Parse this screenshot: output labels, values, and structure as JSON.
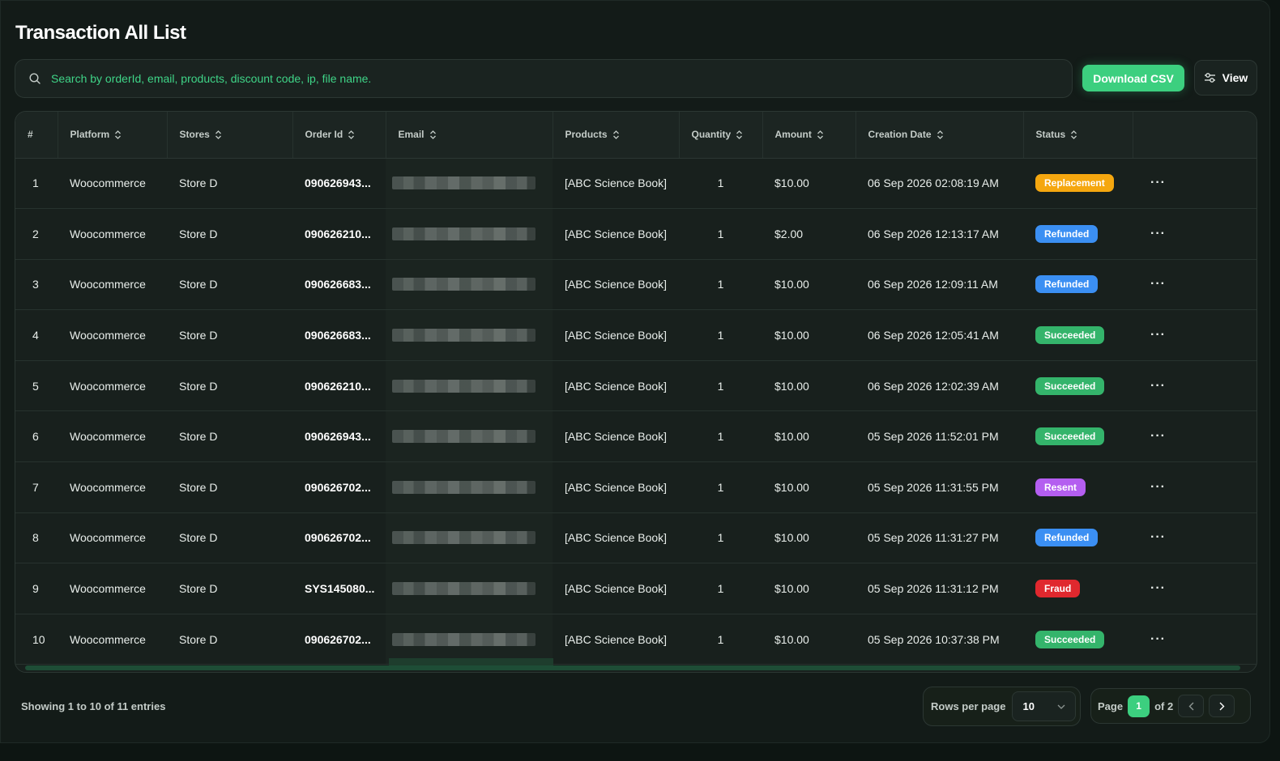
{
  "page": {
    "title": "Transaction All List"
  },
  "search": {
    "placeholder": "Search by orderId, email, products, discount code, ip, file name."
  },
  "toolbar": {
    "download_label": "Download CSV",
    "view_label": "View"
  },
  "table": {
    "columns": [
      "#",
      "Platform",
      "Stores",
      "Order Id",
      "Email",
      "Products",
      "Quantity",
      "Amount",
      "Creation Date",
      "Status"
    ],
    "rows": [
      {
        "num": "1",
        "platform": "Woocommerce",
        "store": "Store D",
        "order_id": "090626943...",
        "product": "[ABC Science Book]",
        "quantity": "1",
        "amount": "$10.00",
        "date": "06 Sep 2026 02:08:19 AM",
        "status": "Replacement"
      },
      {
        "num": "2",
        "platform": "Woocommerce",
        "store": "Store D",
        "order_id": "090626210...",
        "product": "[ABC Science Book]",
        "quantity": "1",
        "amount": "$2.00",
        "date": "06 Sep 2026 12:13:17 AM",
        "status": "Refunded"
      },
      {
        "num": "3",
        "platform": "Woocommerce",
        "store": "Store D",
        "order_id": "090626683...",
        "product": "[ABC Science Book]",
        "quantity": "1",
        "amount": "$10.00",
        "date": "06 Sep 2026 12:09:11 AM",
        "status": "Refunded"
      },
      {
        "num": "4",
        "platform": "Woocommerce",
        "store": "Store D",
        "order_id": "090626683...",
        "product": "[ABC Science Book]",
        "quantity": "1",
        "amount": "$10.00",
        "date": "06 Sep 2026 12:05:41 AM",
        "status": "Succeeded"
      },
      {
        "num": "5",
        "platform": "Woocommerce",
        "store": "Store D",
        "order_id": "090626210...",
        "product": "[ABC Science Book]",
        "quantity": "1",
        "amount": "$10.00",
        "date": "06 Sep 2026 12:02:39 AM",
        "status": "Succeeded"
      },
      {
        "num": "6",
        "platform": "Woocommerce",
        "store": "Store D",
        "order_id": "090626943...",
        "product": "[ABC Science Book]",
        "quantity": "1",
        "amount": "$10.00",
        "date": "05 Sep 2026 11:52:01 PM",
        "status": "Succeeded"
      },
      {
        "num": "7",
        "platform": "Woocommerce",
        "store": "Store D",
        "order_id": "090626702...",
        "product": "[ABC Science Book]",
        "quantity": "1",
        "amount": "$10.00",
        "date": "05 Sep 2026 11:31:55 PM",
        "status": "Resent"
      },
      {
        "num": "8",
        "platform": "Woocommerce",
        "store": "Store D",
        "order_id": "090626702...",
        "product": "[ABC Science Book]",
        "quantity": "1",
        "amount": "$10.00",
        "date": "05 Sep 2026 11:31:27 PM",
        "status": "Refunded"
      },
      {
        "num": "9",
        "platform": "Woocommerce",
        "store": "Store D",
        "order_id": "SYS145080...",
        "product": "[ABC Science Book]",
        "quantity": "1",
        "amount": "$10.00",
        "date": "05 Sep 2026 11:31:12 PM",
        "status": "Fraud"
      },
      {
        "num": "10",
        "platform": "Woocommerce",
        "store": "Store D",
        "order_id": "090626702...",
        "product": "[ABC Science Book]",
        "quantity": "1",
        "amount": "$10.00",
        "date": "05 Sep 2026 10:37:38 PM",
        "status": "Succeeded"
      }
    ]
  },
  "status_colors": {
    "Replacement": "#f5a70f",
    "Refunded": "#3b8ff3",
    "Succeeded": "#34b46b",
    "Resent": "#b45ef0",
    "Fraud": "#e0282e"
  },
  "footer": {
    "showing": "Showing 1 to 10 of 11 entries",
    "rows_per_page_label": "Rows per page",
    "rows_per_page_value": "10",
    "page_label": "Page",
    "current_page": "1",
    "of_pages": "of 2"
  },
  "icons": {
    "search": "search-icon",
    "view": "sliders-icon",
    "sort": "sort-icon",
    "row_menu": "more-horizontal-icon",
    "select": "chevron-down-icon",
    "prev": "chevron-left-icon",
    "next": "chevron-right-icon"
  },
  "colors": {
    "accent": "#3ccf7f",
    "background": "#131b18"
  }
}
